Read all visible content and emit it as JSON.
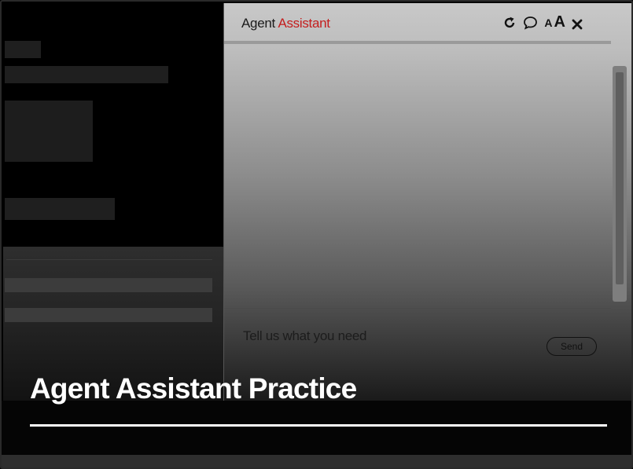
{
  "assistant": {
    "title_prefix": "Agent",
    "title_accent": "Assistant",
    "accent_color": "#c41d1d",
    "icons": [
      "refresh-icon",
      "chat-bubble-icon",
      "font-size-icon",
      "close-icon"
    ],
    "font_small_label": "A",
    "font_large_label": "A",
    "close_label": "✕",
    "input_placeholder": "Tell us what you need",
    "send_label": "Send"
  },
  "banner": {
    "title": "Agent Assistant Practice"
  }
}
